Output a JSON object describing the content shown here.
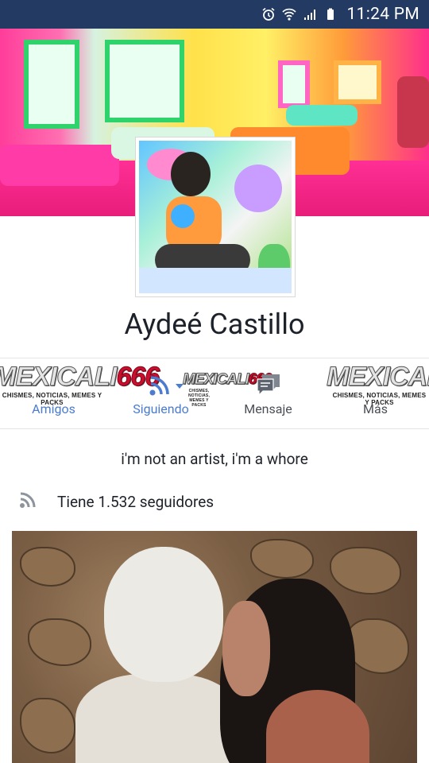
{
  "status_bar": {
    "time": "11:24 PM",
    "icons": [
      "alarm-icon",
      "wifi-icon",
      "signal-icon",
      "battery-icon"
    ]
  },
  "profile": {
    "name": "Aydeé Castillo",
    "bio": "i'm not an artist, i'm a whore",
    "followers_text": "Tiene 1.532 seguidores"
  },
  "actions": [
    {
      "label": "Amigos",
      "icon": "friends-icon"
    },
    {
      "label": "Siguiendo",
      "icon": "rss-following-icon"
    },
    {
      "label": "Mensaje",
      "icon": "message-icon"
    },
    {
      "label": "Más",
      "icon": "more-icon"
    }
  ],
  "watermark": {
    "brand": "MEXICALI",
    "number": "666",
    "tagline": "CHISMES, NOTICIAS, MEMES Y PACKS"
  },
  "colors": {
    "status_bar": "#233a63",
    "link_blue": "#4b7ccf",
    "text": "#1d2129"
  }
}
